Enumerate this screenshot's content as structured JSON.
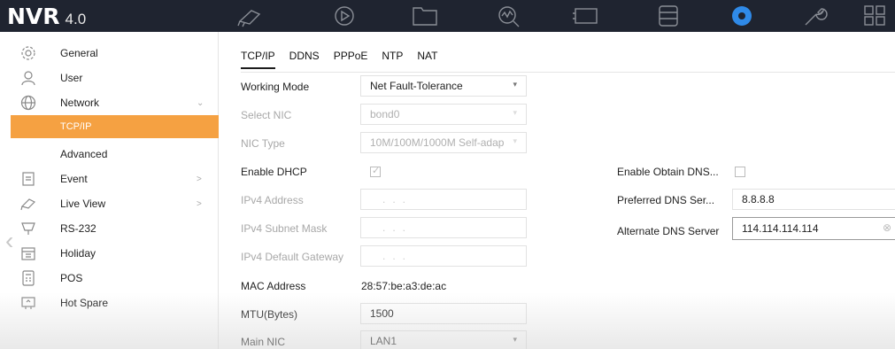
{
  "app": {
    "brand": "NVR",
    "version": "4.0"
  },
  "topbar": {
    "icons": [
      {
        "name": "live-view-icon"
      },
      {
        "name": "playback-icon"
      },
      {
        "name": "file-management-icon"
      },
      {
        "name": "smart-analysis-icon"
      },
      {
        "name": "camera-icon"
      },
      {
        "name": "storage-icon"
      },
      {
        "name": "configuration-icon",
        "active": true
      },
      {
        "name": "maintenance-icon"
      },
      {
        "name": "menu-grid-icon"
      }
    ]
  },
  "sidebar": {
    "items": [
      {
        "label": "General",
        "icon": "general-icon"
      },
      {
        "label": "User",
        "icon": "user-icon"
      },
      {
        "label": "Network",
        "icon": "network-icon",
        "expanded": true
      },
      {
        "label": "TCP/IP",
        "sub": true,
        "active": true
      },
      {
        "label": "Advanced",
        "sub": true
      },
      {
        "label": "Event",
        "icon": "event-icon",
        "arrow": ">"
      },
      {
        "label": "Live View",
        "icon": "live-view-icon",
        "arrow": ">"
      },
      {
        "label": "RS-232",
        "icon": "rs232-icon"
      },
      {
        "label": "Holiday",
        "icon": "holiday-icon"
      },
      {
        "label": "POS",
        "icon": "pos-icon"
      },
      {
        "label": "Hot Spare",
        "icon": "hot-spare-icon"
      }
    ]
  },
  "tabs": [
    "TCP/IP",
    "DDNS",
    "PPPoE",
    "NTP",
    "NAT"
  ],
  "form": {
    "working_mode": {
      "label": "Working Mode",
      "value": "Net Fault-Tolerance"
    },
    "select_nic": {
      "label": "Select NIC",
      "value": "bond0"
    },
    "nic_type": {
      "label": "NIC Type",
      "value": "10M/100M/1000M Self-adap"
    },
    "enable_dhcp": {
      "label": "Enable DHCP",
      "checked": true
    },
    "ipv4_address": {
      "label": "IPv4 Address"
    },
    "ipv4_subnet": {
      "label": "IPv4 Subnet Mask"
    },
    "ipv4_gateway": {
      "label": "IPv4 Default Gateway"
    },
    "mac_address": {
      "label": "MAC Address",
      "value": "28:57:be:a3:de:ac"
    },
    "mtu": {
      "label": "MTU(Bytes)",
      "value": "1500"
    },
    "main_nic": {
      "label": "Main NIC",
      "value": "LAN1"
    },
    "enable_obtain_dns": {
      "label": "Enable Obtain DNS...",
      "checked": false
    },
    "preferred_dns": {
      "label": "Preferred DNS Ser...",
      "value": "8.8.8.8"
    },
    "alternate_dns": {
      "label": "Alternate DNS Server",
      "value": "114.114.114.114"
    }
  },
  "colors": {
    "topbar": "#1f2430",
    "accent": "#f5a142",
    "active_icon": "#2f8ae8"
  }
}
